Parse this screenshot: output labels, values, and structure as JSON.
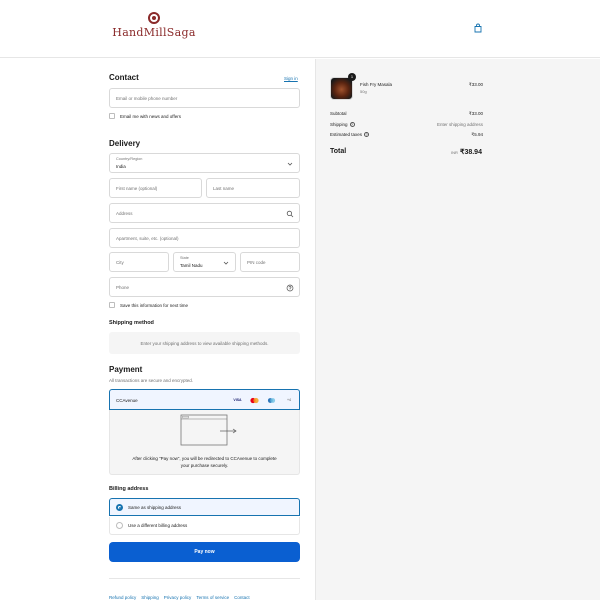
{
  "brand": {
    "name": "HandMillSaga"
  },
  "contact": {
    "title": "Contact",
    "sign_in": "Sign in",
    "email_placeholder": "Email or mobile phone number",
    "news_label": "Email me with news and offers"
  },
  "delivery": {
    "title": "Delivery",
    "country_label": "Country/Region",
    "country_value": "India",
    "first_name_placeholder": "First name (optional)",
    "last_name_placeholder": "Last name",
    "address_placeholder": "Address",
    "apartment_placeholder": "Apartment, suite, etc. (optional)",
    "city_placeholder": "City",
    "state_label": "State",
    "state_value": "Tamil Nadu",
    "pin_placeholder": "PIN code",
    "phone_placeholder": "Phone",
    "save_label": "Save this information for next time"
  },
  "shipping": {
    "title": "Shipping method",
    "note": "Enter your shipping address to view available shipping methods."
  },
  "payment": {
    "title": "Payment",
    "subtitle": "All transactions are secure and encrypted.",
    "method": "CCAvenue",
    "cards": [
      "VISA",
      "MC",
      "AMEX",
      "+4"
    ],
    "note": "After clicking “Pay now”, you will be redirected to CCAvenue to complete your purchase securely."
  },
  "billing": {
    "title": "Billing address",
    "same": "Same as shipping address",
    "different": "Use a different billing address"
  },
  "pay_button": "Pay now",
  "footer": [
    "Refund policy",
    "Shipping",
    "Privacy policy",
    "Terms of service",
    "Contact"
  ],
  "summary": {
    "item_name": "Fish Fry Masala",
    "item_variant": "50g",
    "item_qty": "1",
    "item_price": "₹33.00",
    "subtotal_label": "Subtotal",
    "subtotal_value": "₹33.00",
    "shipping_label": "Shipping",
    "shipping_value": "Enter shipping address",
    "taxes_label": "Estimated taxes",
    "taxes_value": "₹5.94",
    "total_label": "Total",
    "total_currency": "INR",
    "total_value": "₹38.94"
  },
  "colors": {
    "accent": "#1773b0",
    "button": "#0a5fd1",
    "brand": "#8a2a2a"
  }
}
